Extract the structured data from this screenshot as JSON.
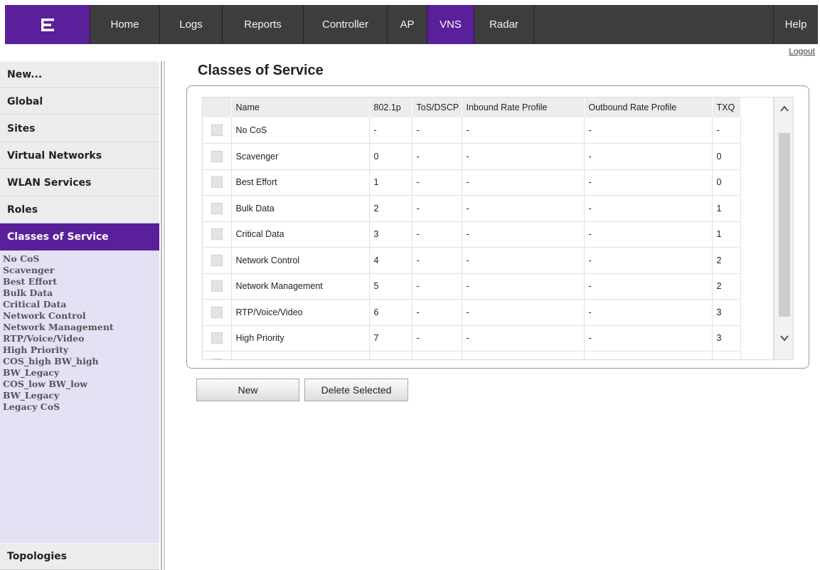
{
  "nav": {
    "items": [
      {
        "label": "Home",
        "width": 98
      },
      {
        "label": "Logs",
        "width": 88
      },
      {
        "label": "Reports",
        "width": 114
      },
      {
        "label": "Controller",
        "width": 118
      },
      {
        "label": "AP",
        "width": 56
      },
      {
        "label": "VNS",
        "width": 66
      },
      {
        "label": "Radar",
        "width": 84
      }
    ],
    "help": "Help",
    "active": "VNS"
  },
  "logout": "Logout",
  "sidebar": {
    "sections_top": [
      "New...",
      "Global",
      "Sites",
      "Virtual Networks",
      "WLAN Services",
      "Roles"
    ],
    "active_section": "Classes of Service",
    "sub_items": [
      "No CoS",
      "Scavenger",
      "Best Effort",
      "Bulk Data",
      "Critical Data",
      "Network Control",
      "Network Management",
      "RTP/Voice/Video",
      "High Priority",
      "COS_high BW_high",
      "BW_Legacy",
      "COS_low BW_low",
      "BW_Legacy",
      "Legacy CoS"
    ],
    "bottom_section": "Topologies"
  },
  "main": {
    "title": "Classes of Service",
    "columns": [
      "",
      "Name",
      "802.1p",
      "ToS/DSCP",
      "Inbound Rate Profile",
      "Outbound Rate Profile",
      "TXQ"
    ],
    "rows": [
      [
        "No CoS",
        "-",
        "-",
        "-",
        "-",
        "-"
      ],
      [
        "Scavenger",
        "0",
        "-",
        "-",
        "-",
        "0"
      ],
      [
        "Best Effort",
        "1",
        "-",
        "-",
        "-",
        "0"
      ],
      [
        "Bulk Data",
        "2",
        "-",
        "-",
        "-",
        "1"
      ],
      [
        "Critical Data",
        "3",
        "-",
        "-",
        "-",
        "1"
      ],
      [
        "Network Control",
        "4",
        "-",
        "-",
        "-",
        "2"
      ],
      [
        "Network Management",
        "5",
        "-",
        "-",
        "-",
        "2"
      ],
      [
        "RTP/Voice/Video",
        "6",
        "-",
        "-",
        "-",
        "3"
      ],
      [
        "High Priority",
        "7",
        "-",
        "-",
        "-",
        "3"
      ]
    ],
    "buttons": {
      "new": "New",
      "delete": "Delete Selected"
    }
  },
  "colors": {
    "accent": "#5a1f9a",
    "nav_bg": "#3d3d3d",
    "sidebar_bg": "#e6e0f4"
  }
}
